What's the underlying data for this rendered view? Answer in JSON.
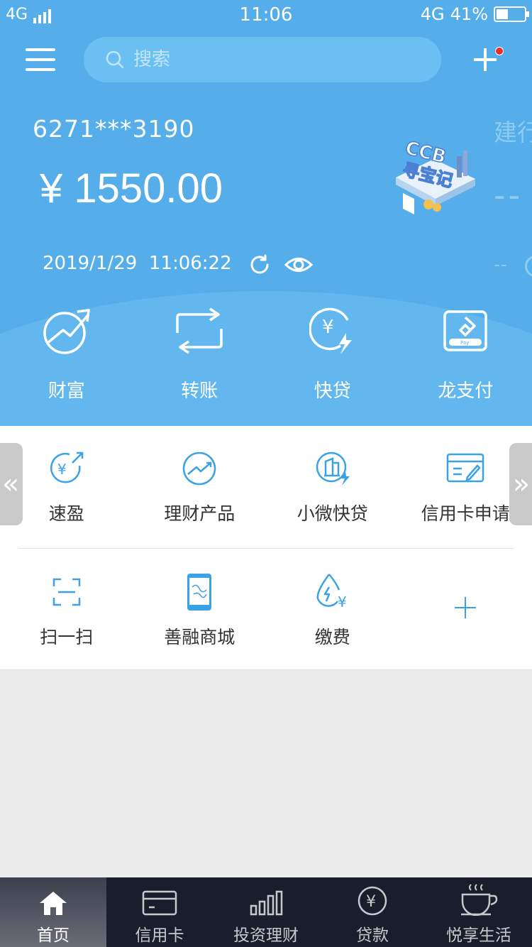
{
  "status_bar": {
    "network_left": "4G",
    "time": "11:06",
    "network_right": "4G",
    "battery": "41%",
    "battery_level": 0.41
  },
  "header": {
    "search_placeholder": "搜索",
    "account_number": "6271***3190",
    "balance": "¥ 1550.00",
    "date": "2019/1/29",
    "time": "11:06:22",
    "promo_banner": "CCB寻宝记",
    "side_card_title": "建行",
    "side_card_value": "--",
    "side_card_sub": "--",
    "background_color": "#55aee9"
  },
  "quick_actions": [
    {
      "label": "财富",
      "icon": "wealth-icon"
    },
    {
      "label": "转账",
      "icon": "transfer-icon"
    },
    {
      "label": "快贷",
      "icon": "quick-loan-icon"
    },
    {
      "label": "龙支付",
      "icon": "long-pay-icon"
    }
  ],
  "services": {
    "row1": [
      {
        "label": "速盈",
        "icon": "suying-icon"
      },
      {
        "label": "理财产品",
        "icon": "financial-products-icon"
      },
      {
        "label": "小微快贷",
        "icon": "small-business-loan-icon"
      },
      {
        "label": "信用卡申请",
        "icon": "credit-card-apply-icon"
      }
    ],
    "row2": [
      {
        "label": "扫一扫",
        "icon": "scan-icon"
      },
      {
        "label": "善融商城",
        "icon": "mall-phone-icon"
      },
      {
        "label": "缴费",
        "icon": "utility-payment-icon"
      },
      {
        "label": "",
        "icon": "add-icon"
      }
    ],
    "pager_left": "«",
    "pager_right": "»",
    "icon_color": "#3aa2e6"
  },
  "tabbar": [
    {
      "label": "首页",
      "icon": "home-icon",
      "active": true
    },
    {
      "label": "信用卡",
      "icon": "credit-card-icon",
      "active": false
    },
    {
      "label": "投资理财",
      "icon": "bar-chart-icon",
      "active": false
    },
    {
      "label": "贷款",
      "icon": "yen-coin-icon",
      "active": false
    },
    {
      "label": "悦享生活",
      "icon": "coffee-cup-icon",
      "active": false
    }
  ]
}
